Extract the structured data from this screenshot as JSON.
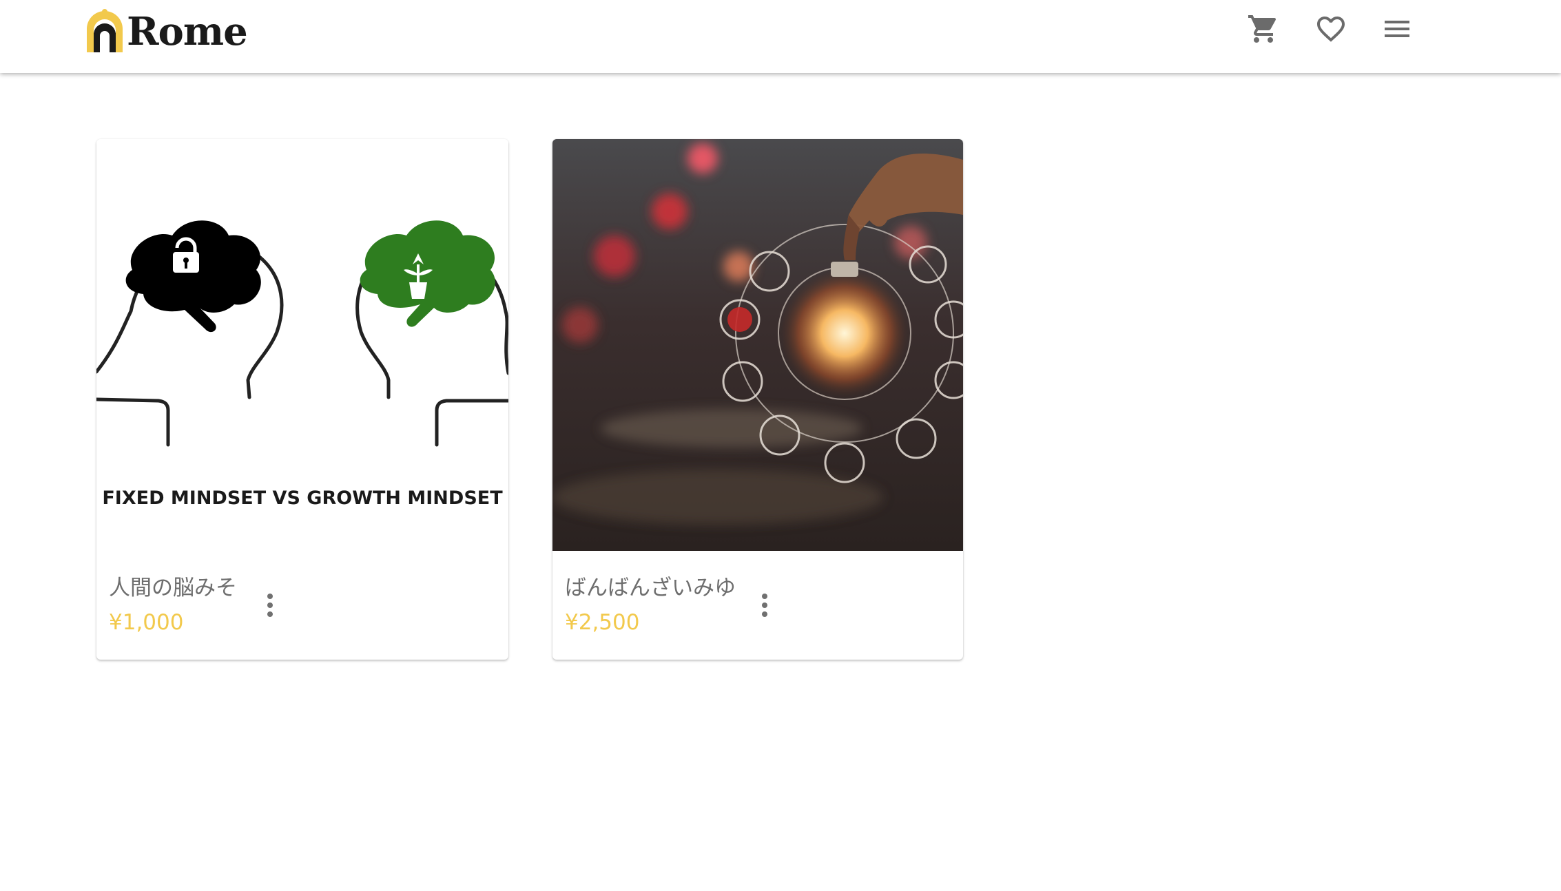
{
  "header": {
    "logo_text": "Rome",
    "icons": {
      "cart": "cart-icon",
      "favorites": "heart-icon",
      "menu": "hamburger-menu-icon"
    }
  },
  "products": [
    {
      "title": "人間の脳みそ",
      "price": "¥1,000",
      "image_caption": "FIXED MINDSET VS GROWTH MINDSET"
    },
    {
      "title": "ばんばんざいみゆ",
      "price": "¥2,500"
    }
  ],
  "colors": {
    "accent": "#f2c94c",
    "logo_text": "#1a1a1a",
    "icon": "#6b6b6b",
    "title_text": "#6e6e6e",
    "growth_brain": "#2e7d1f"
  }
}
